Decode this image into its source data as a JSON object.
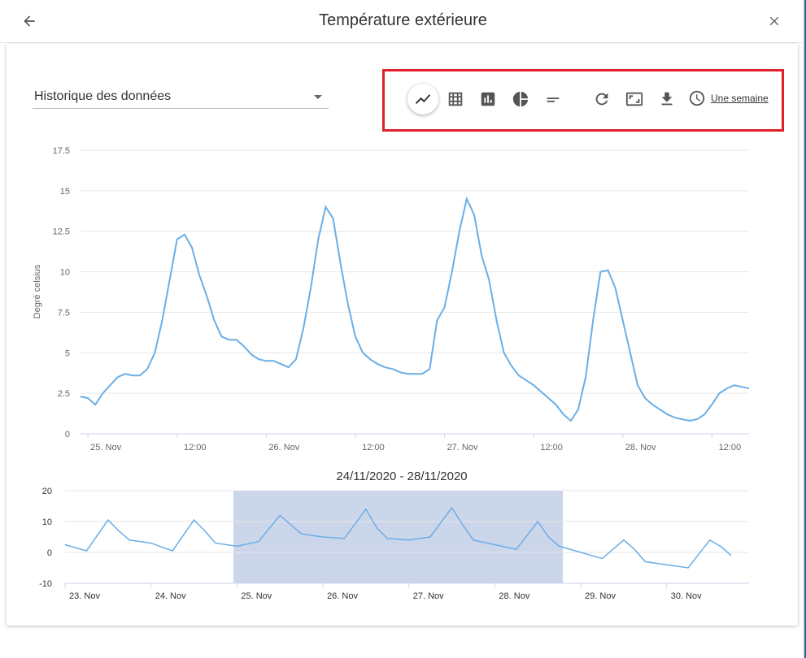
{
  "header": {
    "title": "Température extérieure"
  },
  "select": {
    "value": "Historique des données"
  },
  "toolbar": {
    "items": [
      {
        "icon": "line-chart-icon",
        "active": true
      },
      {
        "icon": "table-icon"
      },
      {
        "icon": "bar-chart-icon"
      },
      {
        "icon": "pie-chart-icon"
      },
      {
        "icon": "minus-icon"
      },
      {
        "icon": "refresh-icon"
      },
      {
        "icon": "fullscreen-icon"
      },
      {
        "icon": "download-icon"
      }
    ],
    "period_label": "Une semaine"
  },
  "range_title": "24/11/2020 - 28/11/2020",
  "colors": {
    "line": "#6aaee6",
    "grid": "#e6e6e6",
    "selection": "#ccd6eb",
    "highlight": "#e0202a"
  },
  "chart_data": [
    {
      "type": "line",
      "ylabel": "Degré celsius",
      "ylim": [
        0,
        17.5
      ],
      "yticks": [
        "0",
        "2.5",
        "5",
        "7.5",
        "10",
        "12.5",
        "15",
        "17.5"
      ],
      "x_tick_labels": [
        "25. Nov",
        "12:00",
        "26. Nov",
        "12:00",
        "27. Nov",
        "12:00",
        "28. Nov",
        "12:00"
      ],
      "grid": true,
      "series": [
        {
          "x": [
            "24/11 23:00",
            "25/11 00:00",
            "25/11 01:00",
            "25/11 02:00",
            "25/11 03:00",
            "25/11 04:00",
            "25/11 05:00",
            "25/11 06:00",
            "25/11 07:00",
            "25/11 08:00",
            "25/11 09:00",
            "25/11 10:00",
            "25/11 11:00",
            "25/11 12:00",
            "25/11 13:00",
            "25/11 14:00",
            "25/11 15:00",
            "25/11 16:00",
            "25/11 17:00",
            "25/11 18:00",
            "25/11 19:00",
            "25/11 20:00",
            "25/11 21:00",
            "25/11 22:00",
            "25/11 23:00",
            "26/11 00:00",
            "26/11 01:00",
            "26/11 02:00",
            "26/11 03:00",
            "26/11 04:00",
            "26/11 05:00",
            "26/11 06:00",
            "26/11 07:00",
            "26/11 08:00",
            "26/11 09:00",
            "26/11 10:00",
            "26/11 11:00",
            "26/11 12:00",
            "26/11 13:00",
            "26/11 14:00",
            "26/11 15:00",
            "26/11 16:00",
            "26/11 17:00",
            "26/11 18:00",
            "26/11 19:00",
            "26/11 20:00",
            "26/11 21:00",
            "26/11 22:00",
            "26/11 23:00",
            "27/11 00:00",
            "27/11 01:00",
            "27/11 02:00",
            "27/11 03:00",
            "27/11 04:00",
            "27/11 05:00",
            "27/11 06:00",
            "27/11 07:00",
            "27/11 08:00",
            "27/11 09:00",
            "27/11 10:00",
            "27/11 11:00",
            "27/11 12:00",
            "27/11 13:00",
            "27/11 14:00",
            "27/11 15:00",
            "27/11 16:00",
            "27/11 17:00",
            "27/11 18:00",
            "27/11 19:00",
            "27/11 20:00",
            "27/11 21:00",
            "27/11 22:00",
            "27/11 23:00",
            "28/11 00:00",
            "28/11 01:00",
            "28/11 02:00",
            "28/11 03:00",
            "28/11 04:00",
            "28/11 05:00",
            "28/11 06:00",
            "28/11 07:00",
            "28/11 08:00",
            "28/11 09:00",
            "28/11 10:00",
            "28/11 11:00",
            "28/11 12:00",
            "28/11 13:00",
            "28/11 14:00",
            "28/11 15:00",
            "28/11 16:00",
            "28/11 17:00"
          ],
          "values": [
            2.3,
            2.2,
            1.8,
            2.5,
            3.0,
            3.5,
            3.7,
            3.6,
            3.6,
            4.0,
            5.0,
            7.0,
            9.5,
            12.0,
            12.3,
            11.5,
            9.8,
            8.5,
            7.0,
            6.0,
            5.8,
            5.8,
            5.4,
            4.9,
            4.6,
            4.5,
            4.5,
            4.3,
            4.1,
            4.6,
            6.5,
            9.0,
            12.0,
            14.0,
            13.3,
            10.5,
            8.0,
            6.0,
            5.0,
            4.6,
            4.3,
            4.1,
            4.0,
            3.8,
            3.7,
            3.7,
            3.7,
            4.0,
            7.0,
            7.8,
            10.0,
            12.5,
            14.5,
            13.5,
            11.0,
            9.5,
            7.0,
            5.0,
            4.2,
            3.6,
            3.3,
            3.0,
            2.6,
            2.2,
            1.8,
            1.2,
            0.8,
            1.5,
            3.5,
            7.0,
            10.0,
            10.1,
            9.0,
            7.0,
            5.0,
            3.0,
            2.2,
            1.8,
            1.5,
            1.2,
            1.0,
            0.9,
            0.8,
            0.9,
            1.2,
            1.8,
            2.5,
            2.8,
            3.0,
            2.9,
            2.8
          ]
        }
      ]
    },
    {
      "type": "area",
      "title": "24/11/2020 - 28/11/2020",
      "ylim": [
        -10,
        20
      ],
      "yticks": [
        "-10",
        "0",
        "10",
        "20"
      ],
      "x_tick_labels": [
        "23. Nov",
        "24. Nov",
        "25. Nov",
        "26. Nov",
        "27. Nov",
        "28. Nov",
        "29. Nov",
        "30. Nov"
      ],
      "selection": [
        "24/11/2020 23:00",
        "28/11/2020 19:00"
      ],
      "series": [
        {
          "x": [
            "23/11 00:00",
            "23/11 06:00",
            "23/11 12:00",
            "23/11 15:00",
            "23/11 18:00",
            "24/11 00:00",
            "24/11 06:00",
            "24/11 12:00",
            "24/11 15:00",
            "24/11 18:00",
            "25/11 00:00",
            "25/11 06:00",
            "25/11 12:00",
            "25/11 15:00",
            "25/11 18:00",
            "26/11 00:00",
            "26/11 06:00",
            "26/11 12:00",
            "26/11 15:00",
            "26/11 18:00",
            "27/11 00:00",
            "27/11 06:00",
            "27/11 12:00",
            "27/11 15:00",
            "27/11 18:00",
            "28/11 00:00",
            "28/11 06:00",
            "28/11 12:00",
            "28/11 15:00",
            "28/11 18:00",
            "29/11 00:00",
            "29/11 06:00",
            "29/11 12:00",
            "29/11 15:00",
            "29/11 18:00",
            "30/11 00:00",
            "30/11 06:00",
            "30/11 12:00",
            "30/11 15:00",
            "30/11 18:00"
          ],
          "values": [
            2.5,
            0.5,
            10.5,
            7,
            4,
            3,
            0.5,
            10.5,
            7,
            3,
            2,
            3.5,
            12,
            9,
            6,
            5,
            4.5,
            14,
            8,
            4.5,
            4,
            5,
            14.5,
            9,
            4,
            2.5,
            1,
            10,
            5,
            2,
            0,
            -2,
            4,
            1,
            -3,
            -4,
            -5,
            4,
            2,
            -1
          ]
        }
      ]
    }
  ]
}
